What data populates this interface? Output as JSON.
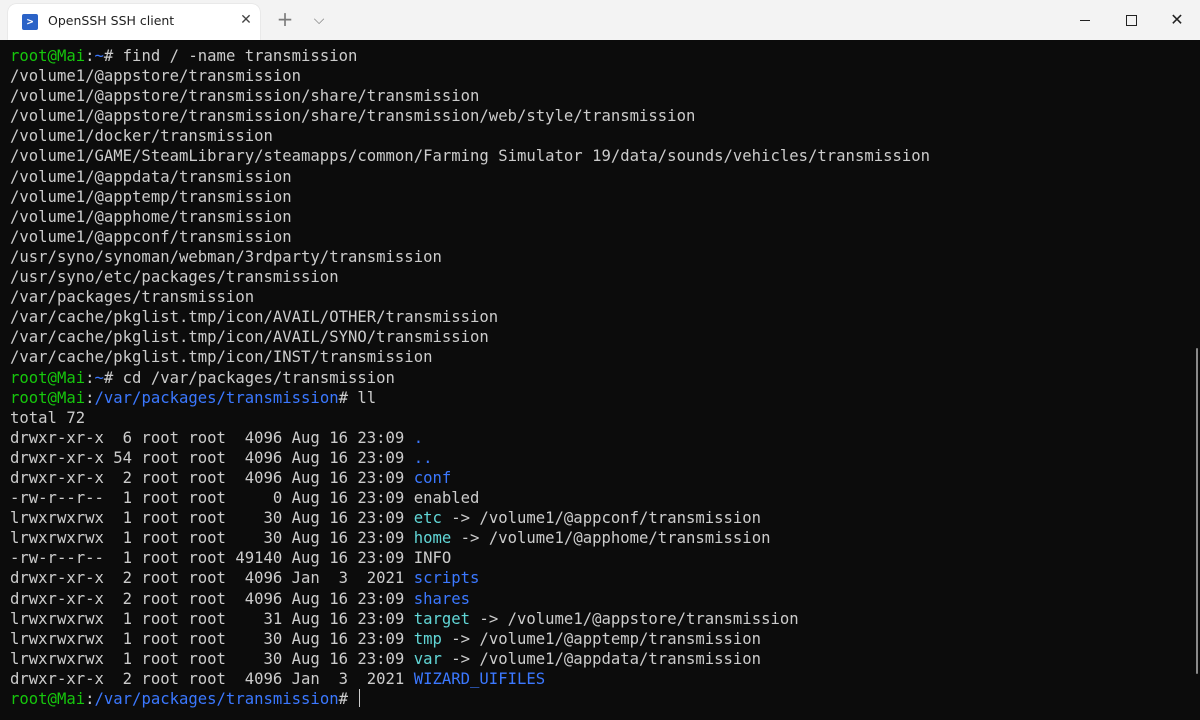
{
  "window": {
    "tab_title": "OpenSSH SSH client",
    "tab_close": "✕",
    "new_tab": "+",
    "dropdown": "⌵",
    "close": "✕",
    "icons": [
      "powershell-icon",
      "close-icon",
      "plus-icon",
      "chevron-down-icon",
      "minimize-icon",
      "maximize-icon",
      "close-icon"
    ]
  },
  "colors": {
    "background": "#0c0c0c",
    "text": "#cccccc",
    "prompt_user": "#16c60c",
    "prompt_path": "#3b78ff",
    "dir_color": "#3b78ff",
    "link_color": "#61d6d6"
  },
  "terminal": {
    "lines": [
      [
        [
          "root@Mai",
          "g"
        ],
        [
          ":",
          "w"
        ],
        [
          "~",
          "b"
        ],
        [
          "# find / -name transmission",
          "w"
        ]
      ],
      [
        [
          "/volume1/@appstore/transmission",
          "w"
        ]
      ],
      [
        [
          "/volume1/@appstore/transmission/share/transmission",
          "w"
        ]
      ],
      [
        [
          "/volume1/@appstore/transmission/share/transmission/web/style/transmission",
          "w"
        ]
      ],
      [
        [
          "/volume1/docker/transmission",
          "w"
        ]
      ],
      [
        [
          "/volume1/GAME/SteamLibrary/steamapps/common/Farming Simulator 19/data/sounds/vehicles/transmission",
          "w"
        ]
      ],
      [
        [
          "/volume1/@appdata/transmission",
          "w"
        ]
      ],
      [
        [
          "/volume1/@apptemp/transmission",
          "w"
        ]
      ],
      [
        [
          "/volume1/@apphome/transmission",
          "w"
        ]
      ],
      [
        [
          "/volume1/@appconf/transmission",
          "w"
        ]
      ],
      [
        [
          "/usr/syno/synoman/webman/3rdparty/transmission",
          "w"
        ]
      ],
      [
        [
          "/usr/syno/etc/packages/transmission",
          "w"
        ]
      ],
      [
        [
          "/var/packages/transmission",
          "w"
        ]
      ],
      [
        [
          "/var/cache/pkglist.tmp/icon/AVAIL/OTHER/transmission",
          "w"
        ]
      ],
      [
        [
          "/var/cache/pkglist.tmp/icon/AVAIL/SYNO/transmission",
          "w"
        ]
      ],
      [
        [
          "/var/cache/pkglist.tmp/icon/INST/transmission",
          "w"
        ]
      ],
      [
        [
          "root@Mai",
          "g"
        ],
        [
          ":",
          "w"
        ],
        [
          "~",
          "b"
        ],
        [
          "# cd /var/packages/transmission",
          "w"
        ]
      ],
      [
        [
          "root@Mai",
          "g"
        ],
        [
          ":",
          "w"
        ],
        [
          "/var/packages/transmission",
          "b"
        ],
        [
          "# ll",
          "w"
        ]
      ],
      [
        [
          "total 72",
          "w"
        ]
      ],
      [
        [
          "drwxr-xr-x  6 root root  4096 Aug 16 23:09 ",
          "w"
        ],
        [
          ".",
          "b"
        ]
      ],
      [
        [
          "drwxr-xr-x 54 root root  4096 Aug 16 23:09 ",
          "w"
        ],
        [
          "..",
          "b"
        ]
      ],
      [
        [
          "drwxr-xr-x  2 root root  4096 Aug 16 23:09 ",
          "w"
        ],
        [
          "conf",
          "b"
        ]
      ],
      [
        [
          "-rw-r--r--  1 root root     0 Aug 16 23:09 enabled",
          "w"
        ]
      ],
      [
        [
          "lrwxrwxrwx  1 root root    30 Aug 16 23:09 ",
          "w"
        ],
        [
          "etc",
          "c"
        ],
        [
          " -> /volume1/@appconf/transmission",
          "w"
        ]
      ],
      [
        [
          "lrwxrwxrwx  1 root root    30 Aug 16 23:09 ",
          "w"
        ],
        [
          "home",
          "c"
        ],
        [
          " -> /volume1/@apphome/transmission",
          "w"
        ]
      ],
      [
        [
          "-rw-r--r--  1 root root 49140 Aug 16 23:09 INFO",
          "w"
        ]
      ],
      [
        [
          "drwxr-xr-x  2 root root  4096 Jan  3  2021 ",
          "w"
        ],
        [
          "scripts",
          "b"
        ]
      ],
      [
        [
          "drwxr-xr-x  2 root root  4096 Aug 16 23:09 ",
          "w"
        ],
        [
          "shares",
          "b"
        ]
      ],
      [
        [
          "lrwxrwxrwx  1 root root    31 Aug 16 23:09 ",
          "w"
        ],
        [
          "target",
          "c"
        ],
        [
          " -> /volume1/@appstore/transmission",
          "w"
        ]
      ],
      [
        [
          "lrwxrwxrwx  1 root root    30 Aug 16 23:09 ",
          "w"
        ],
        [
          "tmp",
          "c"
        ],
        [
          " -> /volume1/@apptemp/transmission",
          "w"
        ]
      ],
      [
        [
          "lrwxrwxrwx  1 root root    30 Aug 16 23:09 ",
          "w"
        ],
        [
          "var",
          "c"
        ],
        [
          " -> /volume1/@appdata/transmission",
          "w"
        ]
      ],
      [
        [
          "drwxr-xr-x  2 root root  4096 Jan  3  2021 ",
          "w"
        ],
        [
          "WIZARD_UIFILES",
          "b"
        ]
      ],
      [
        [
          "root@Mai",
          "g"
        ],
        [
          ":",
          "w"
        ],
        [
          "/var/packages/transmission",
          "b"
        ],
        [
          "# ",
          "w"
        ]
      ]
    ]
  }
}
